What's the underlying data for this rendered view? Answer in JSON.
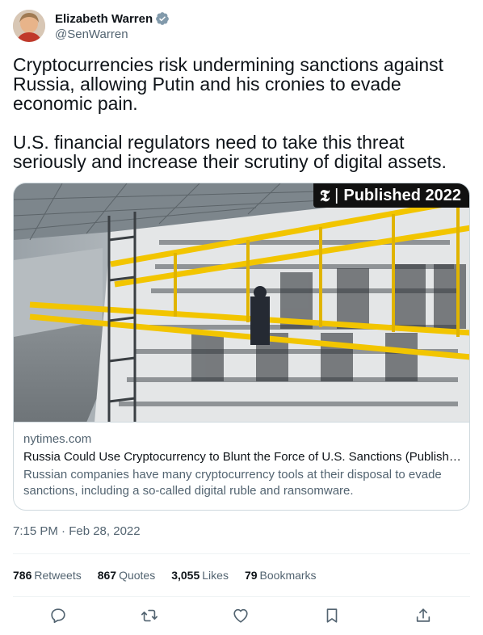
{
  "author": {
    "name": "Elizabeth Warren",
    "handle": "@SenWarren",
    "verified_color": "#829aab"
  },
  "tweet": {
    "paragraph_1": "Cryptocurrencies risk undermining sanctions against Russia, allowing Putin and his cronies to evade economic pain.",
    "paragraph_2": "U.S. financial regulators need to take this threat seriously and increase their scrutiny of digital assets."
  },
  "card": {
    "badge_logo": "𝕿",
    "badge_text": "Published 2022",
    "domain": "nytimes.com",
    "title": "Russia Could Use Cryptocurrency to Blunt the Force of U.S. Sanctions (Published 2022)",
    "description": "Russian companies have many cryptocurrency tools at their disposal to evade sanctions, including a so-called digital ruble and ransomware."
  },
  "timestamp": "7:15 PM · Feb 28, 2022",
  "stats": {
    "retweets_count": "786",
    "retweets_label": "Retweets",
    "quotes_count": "867",
    "quotes_label": "Quotes",
    "likes_count": "3,055",
    "likes_label": "Likes",
    "bookmarks_count": "79",
    "bookmarks_label": "Bookmarks"
  },
  "icons": {
    "reply": "reply-icon",
    "retweet": "retweet-icon",
    "like": "heart-icon",
    "bookmark": "bookmark-icon",
    "share": "share-icon"
  },
  "colors": {
    "text": "#0f1419",
    "secondary": "#536471",
    "border": "#cfd9de",
    "accent_yellow": "#f2c500"
  }
}
